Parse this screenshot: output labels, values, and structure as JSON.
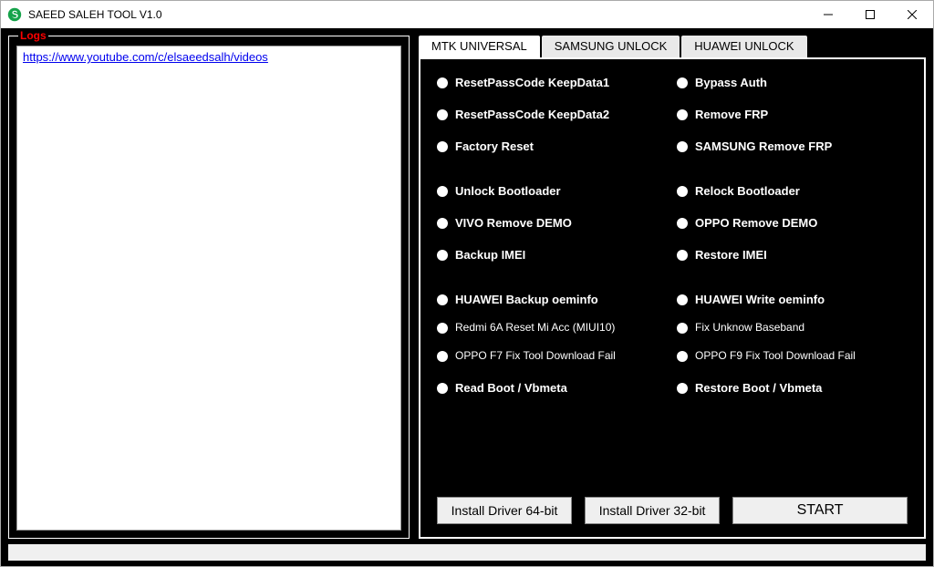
{
  "window": {
    "title": "SAEED SALEH TOOL V1.0"
  },
  "logs": {
    "label": "Logs",
    "link": "https://www.youtube.com/c/elsaeedsalh/videos"
  },
  "tabs": [
    {
      "label": "MTK UNIVERSAL",
      "active": true
    },
    {
      "label": "SAMSUNG UNLOCK",
      "active": false
    },
    {
      "label": "HUAWEI UNLOCK",
      "active": false
    }
  ],
  "options_left": [
    "ResetPassCode KeepData1",
    "ResetPassCode KeepData2",
    "Factory Reset",
    "Unlock Bootloader",
    "VIVO Remove DEMO",
    "Backup IMEI",
    "HUAWEI Backup oeminfo",
    "Redmi 6A Reset Mi Acc (MIUI10)",
    "OPPO F7 Fix Tool Download Fail",
    "Read Boot / Vbmeta"
  ],
  "options_right": [
    "Bypass Auth",
    "Remove FRP",
    "SAMSUNG Remove FRP",
    "Relock Bootloader",
    "OPPO Remove DEMO",
    "Restore IMEI",
    "HUAWEI Write oeminfo",
    "Fix Unknow Baseband",
    "OPPO F9 Fix Tool Download Fail",
    "Restore Boot / Vbmeta"
  ],
  "option_small_indices": [
    7,
    8
  ],
  "option_row_gaps": [
    20,
    20,
    34,
    20,
    20,
    34,
    16,
    16,
    20
  ],
  "buttons": {
    "install64": "Install Driver 64-bit",
    "install32": "Install Driver 32-bit",
    "start": "START"
  }
}
